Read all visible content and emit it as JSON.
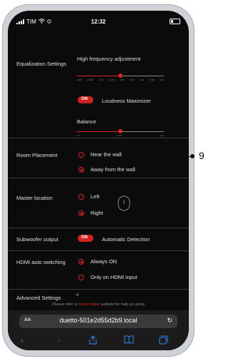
{
  "status_bar": {
    "carrier": "TIM",
    "time": "12:32"
  },
  "equalization": {
    "label": "Equalization Settings",
    "high_freq": {
      "title": "High frequency adjustment",
      "value_fraction": 0.5,
      "ticks": [
        "-6dB",
        "-4.5dB",
        "-3dB",
        "-1.5dB",
        "0dB",
        "1.5dB",
        "3dB",
        "4.5dB",
        "6dB"
      ]
    },
    "loudness": {
      "toggle_label": "ON",
      "text": "Loudness Maximizer"
    },
    "balance": {
      "title": "Balance",
      "value_fraction": 0.5,
      "ticks": [
        "left",
        "center",
        "right"
      ]
    }
  },
  "room_placement": {
    "label": "Room Placement",
    "options": [
      {
        "text": "Near the wall",
        "selected": false
      },
      {
        "text": "Away from the wall",
        "selected": true
      }
    ]
  },
  "master_location": {
    "label": "Master location",
    "options": [
      {
        "text": "Left",
        "selected": false
      },
      {
        "text": "Right",
        "selected": true
      }
    ]
  },
  "subwoofer": {
    "label": "Subwoofer output",
    "toggle_label": "ON",
    "text": "Automatic Detection"
  },
  "hdmi": {
    "label": "HDMI auto switching",
    "options": [
      {
        "text": "Always ON",
        "selected": true
      },
      {
        "text": "Only on HDMI input",
        "selected": false
      }
    ]
  },
  "advanced": {
    "label": "Advanced Settings",
    "chevron": "^"
  },
  "footer": {
    "prefix": "Please refer to ",
    "link": "Sonus faber",
    "suffix": " website for help on setup"
  },
  "browser": {
    "aa": "AA",
    "url": "duetto-501e2d55d2b9.local"
  },
  "callout": {
    "number": "9"
  },
  "colors": {
    "accent": "#d0231f",
    "background": "#0b0b0b",
    "link_blue": "#2f7fe8"
  }
}
